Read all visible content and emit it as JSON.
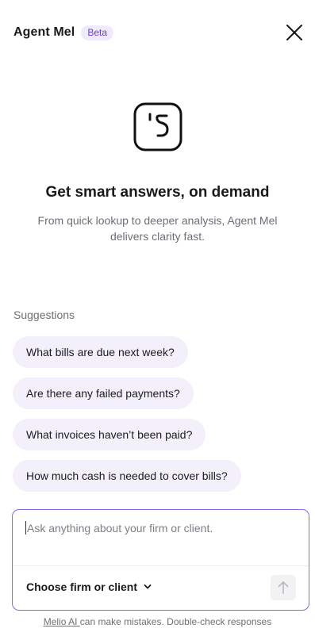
{
  "header": {
    "title": "Agent Mel",
    "badge": "Beta",
    "close_icon": "close-icon"
  },
  "hero": {
    "icon": "agent-face-icon",
    "headline": "Get smart answers, on demand",
    "subtext": "From quick lookup to deeper analysis, Agent Mel delivers clarity fast."
  },
  "suggestions": {
    "label": "Suggestions",
    "items": [
      "What bills are due next week?",
      "Are there any failed payments?",
      "What invoices haven’t been paid?",
      "How much cash is needed to cover bills?"
    ]
  },
  "composer": {
    "placeholder": "Ask anything about your firm or client.",
    "selector_label": "Choose firm or client",
    "selector_icon": "chevron-down-icon",
    "send_icon": "arrow-up-icon"
  },
  "footer": {
    "link": "Melio AI ",
    "text": "can make mistakes. Double-check responses"
  },
  "colors": {
    "accent": "#8b6ce0",
    "badge_text": "#6a3fd4",
    "chip_bg": "#f3f0fb"
  }
}
